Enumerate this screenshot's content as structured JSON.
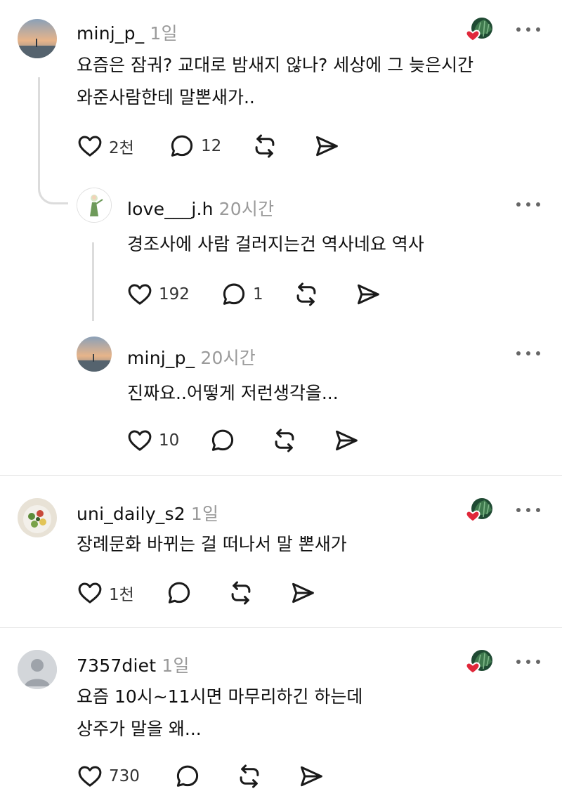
{
  "threads": [
    {
      "username": "minj_p_",
      "time": "1일",
      "text_lines": [
        "요즘은 잠궈? 교대로 밤새지 않나? 세상에 그 늦은시간",
        "와준사람한테 말뽄새가.."
      ],
      "likes": "2천",
      "replies": "12",
      "author_liked": true
    },
    {
      "username": "love___j.h",
      "time": "20시간",
      "text_lines": [
        "경조사에 사람 걸러지는건 역사네요 역사"
      ],
      "likes": "192",
      "replies": "1"
    },
    {
      "username": "minj_p_",
      "time": "20시간",
      "text_lines": [
        "진짜요..어떻게 저런생각을..."
      ],
      "likes": "10",
      "replies": ""
    },
    {
      "username": "uni_daily_s2",
      "time": "1일",
      "text_lines": [
        "장례문화 바뀌는 걸 떠나서 말 뽄새가"
      ],
      "likes": "1천",
      "replies": "",
      "author_liked": true
    },
    {
      "username": "7357diet",
      "time": "1일",
      "text_lines": [
        "요즘 10시~11시면 마무리하긴 하는데",
        "상주가 말을 왜..."
      ],
      "likes": "730",
      "replies": "",
      "author_liked": true
    }
  ],
  "icons": {
    "like": "heart-outline-icon",
    "reply": "comment-bubble-icon",
    "repost": "repost-icon",
    "share": "send-icon",
    "more": "more-dots-icon",
    "author_liked": "author-liked-badge-icon"
  },
  "colors": {
    "text": "#101010",
    "muted": "#9a9a9a",
    "heart_red": "#e0283a",
    "divider": "#e4e4e4"
  }
}
